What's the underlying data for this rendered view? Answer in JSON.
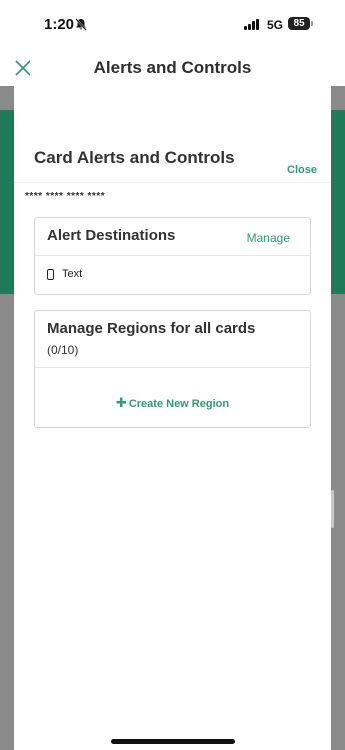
{
  "status_bar": {
    "time": "1:20",
    "network": "5G",
    "battery": "85",
    "icons": [
      "bell-off-icon",
      "signal-icon",
      "battery-icon"
    ]
  },
  "header": {
    "title": "Alerts and Controls",
    "close_icon": "close-icon"
  },
  "modal": {
    "title": "Card Alerts and Controls",
    "close_label": "Close",
    "card_mask": "**** **** **** ****",
    "alert_destinations": {
      "title": "Alert Destinations",
      "manage_label": "Manage",
      "items": [
        {
          "icon": "phone-icon",
          "label": "Text"
        }
      ]
    },
    "regions": {
      "title": "Manage Regions for all cards",
      "count": "(0/10)",
      "create_label": "Create New Region",
      "create_icon": "plus-icon"
    }
  },
  "colors": {
    "accent": "#2e9d73",
    "background_green": "#1e7a58",
    "overlay_gray": "#8a8a8a"
  }
}
